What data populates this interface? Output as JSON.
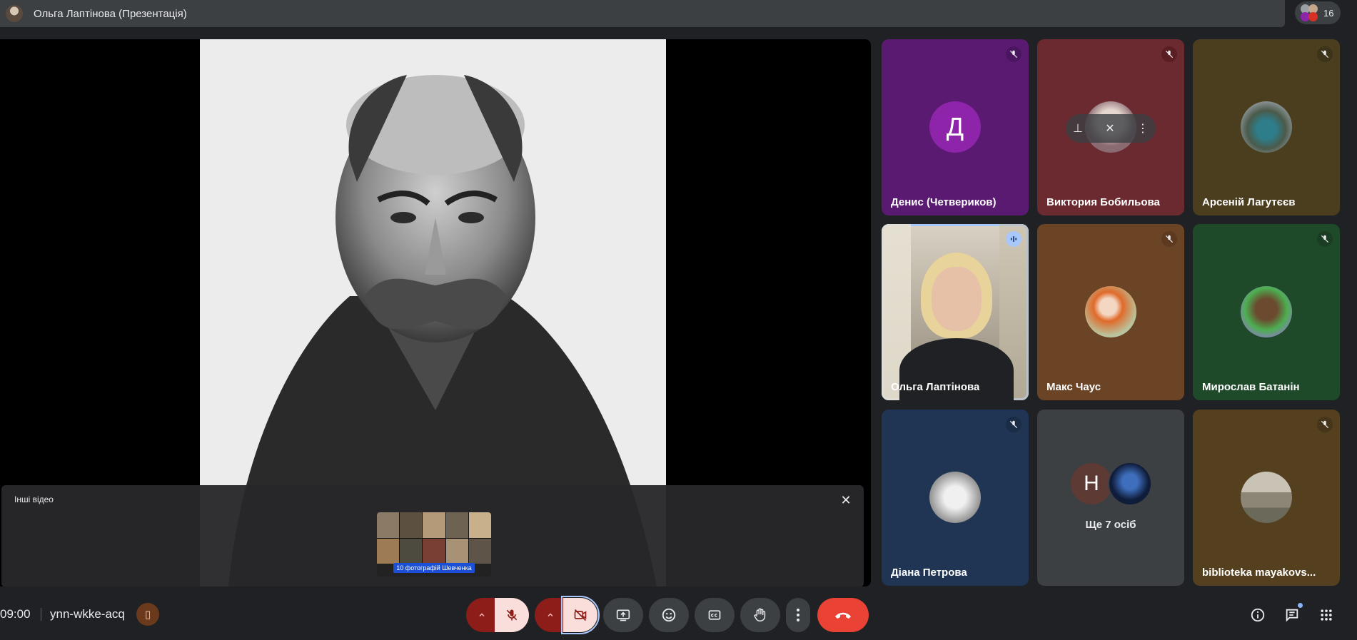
{
  "topbar": {
    "title": "Ольга Лаптінова (Презентація)",
    "participant_count": "16"
  },
  "other_videos": {
    "title": "Інші відео",
    "thumbnail_caption": "10 фотографій Шевченка"
  },
  "tiles": [
    {
      "name": "Денис (Четвериков)",
      "avatar_letter": "Д",
      "avatar_color": "#8e24aa",
      "muted": true
    },
    {
      "name": "Виктория Бобильова",
      "muted": true
    },
    {
      "name": "Арсеній Лагутєєв",
      "muted": true
    },
    {
      "name": "Ольга Лаптінова",
      "speaking": true
    },
    {
      "name": "Макс Чаус",
      "muted": true
    },
    {
      "name": "Мирослав Батанін",
      "muted": true
    },
    {
      "name": "Діана Петрова",
      "muted": true
    },
    {
      "more_letter": "Н",
      "more_label": "Ще 7 осіб"
    },
    {
      "name": "biblioteka mayakovs...",
      "muted": true
    }
  ],
  "bottombar": {
    "time": "09:00",
    "meeting_code": "ynn-wkke-acq"
  },
  "colors": {
    "end_call": "#ea4335",
    "muted_bg": "#f9dedc",
    "muted_fg": "#8c1d18",
    "speaking_outline": "#a8c7fa"
  },
  "icons": [
    "mic-off-icon",
    "camera-off-icon",
    "present-icon",
    "emoji-icon",
    "captions-icon",
    "raise-hand-icon",
    "more-icon",
    "hang-up-icon",
    "info-icon",
    "chat-icon",
    "activities-icon"
  ]
}
